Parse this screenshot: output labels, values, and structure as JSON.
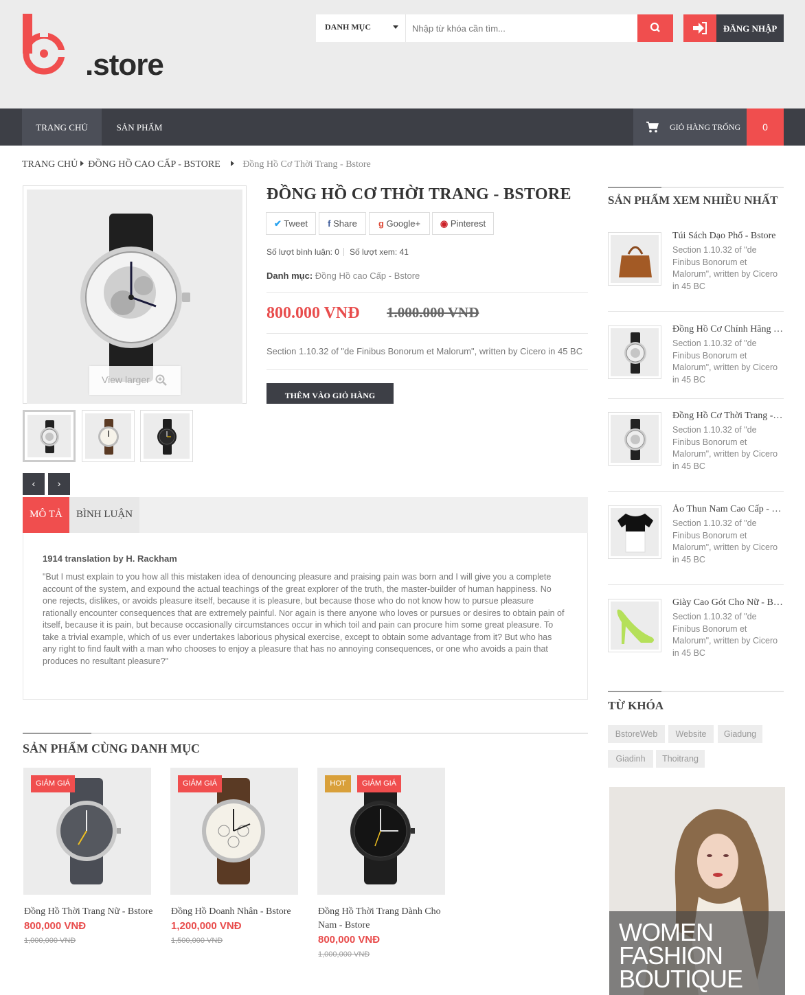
{
  "header": {
    "logo_text": ".store",
    "category_select": "DANH MỤC",
    "search_placeholder": "Nhập từ khóa cần tìm...",
    "login_label": "ĐĂNG NHẬP"
  },
  "nav": {
    "items": [
      "TRANG CHỦ",
      "SẢN PHẨM"
    ],
    "cart_label": "GIỎ HÀNG TRỐNG",
    "cart_count": "0"
  },
  "breadcrumb": {
    "home": "TRANG CHỦ",
    "category": "ĐỒNG HỒ CAO CẤP - BSTORE",
    "current": "Đồng Hồ Cơ Thời Trang - Bstore"
  },
  "product": {
    "title": "ĐỒNG HỒ CƠ THỜI TRANG - BSTORE",
    "view_larger": "View larger",
    "share": {
      "tweet": "Tweet",
      "facebook": "Share",
      "google": "Google+",
      "pinterest": "Pinterest"
    },
    "comments_count": "Số lượt bình luận: 0",
    "views_count": "Số lượt xem: 41",
    "category_label": "Danh mục:",
    "category_value": "Đồng Hồ cao Cấp - Bstore",
    "price": "800.000 VNĐ",
    "old_price": "1.000.000 VNĐ",
    "short_desc": "Section 1.10.32 of \"de Finibus Bonorum et Malorum\", written by Cicero in 45 BC",
    "add_to_cart": "THÊM VÀO GIỎ HÀNG",
    "prev": "‹",
    "next": "›"
  },
  "tabs": {
    "description": "MÔ TẢ",
    "comments": "BÌNH LUẬN",
    "heading": "1914 translation by H. Rackham",
    "body": "\"But I must explain to you how all this mistaken idea of denouncing pleasure and praising pain was born and I will give you a complete account of the system, and expound the actual teachings of the great explorer of the truth, the master-builder of human happiness. No one rejects, dislikes, or avoids pleasure itself, because it is pleasure, but because those who do not know how to pursue pleasure rationally encounter consequences that are extremely painful. Nor again is there anyone who loves or pursues or desires to obtain pain of itself, because it is pain, but because occasionally circumstances occur in which toil and pain can procure him some great pleasure. To take a trivial example, which of us ever undertakes laborious physical exercise, except to obtain some advantage from it? But who has any right to find fault with a man who chooses to enjoy a pleasure that has no annoying consequences, or one who avoids a pain that produces no resultant pleasure?\""
  },
  "related": {
    "title": "SẢN PHẨM CÙNG DANH MỤC",
    "items": [
      {
        "badges": [
          "GIẢM GIÁ"
        ],
        "name": "Đồng Hồ Thời Trang Nữ - Bstore",
        "price": "800,000 VNĐ",
        "old_price": "1,000,000 VNĐ"
      },
      {
        "badges": [
          "GIẢM GIÁ"
        ],
        "name": "Đồng Hồ Doanh Nhân - Bstore",
        "price": "1,200,000 VNĐ",
        "old_price": "1,500,000 VNĐ"
      },
      {
        "badges": [
          "HOT",
          "GIẢM GIÁ"
        ],
        "name": "Đồng Hồ Thời Trang Dành Cho Nam - Bstore",
        "price": "800,000 VNĐ",
        "old_price": "1,000,000 VNĐ"
      }
    ]
  },
  "sidebar": {
    "most_viewed_title": "SẢN PHẨM XEM NHIỀU NHẤT",
    "most_viewed": [
      {
        "name": "Túi Sách Dạo Phố - Bstore",
        "desc": "Section 1.10.32 of \"de Finibus Bonorum et Malorum\", written by Cicero in 45 BC"
      },
      {
        "name": "Đồng Hồ Cơ Chính Hãng - Bstore",
        "desc": "Section 1.10.32 of \"de Finibus Bonorum et Malorum\", written by Cicero in 45 BC"
      },
      {
        "name": "Đồng Hồ Cơ Thời Trang - Bstore",
        "desc": "Section 1.10.32 of \"de Finibus Bonorum et Malorum\", written by Cicero in 45 BC"
      },
      {
        "name": "Áo Thun Nam Cao Cấp - Bstore",
        "desc": "Section 1.10.32 of \"de Finibus Bonorum et Malorum\", written by Cicero in 45 BC"
      },
      {
        "name": "Giày Cao Gót Cho Nữ - Bstore",
        "desc": "Section 1.10.32 of \"de Finibus Bonorum et Malorum\", written by Cicero in 45 BC"
      }
    ],
    "tags_title": "TỪ KHÓA",
    "tags": [
      "BstoreWeb",
      "Website",
      "Giadung",
      "Giadinh",
      "Thoitrang"
    ],
    "banner_text": "WOMEN FASHION BOUTIQUE"
  },
  "colors": {
    "accent": "#f04e4e",
    "dark": "#3d3f46",
    "header_bg": "#ececec"
  }
}
